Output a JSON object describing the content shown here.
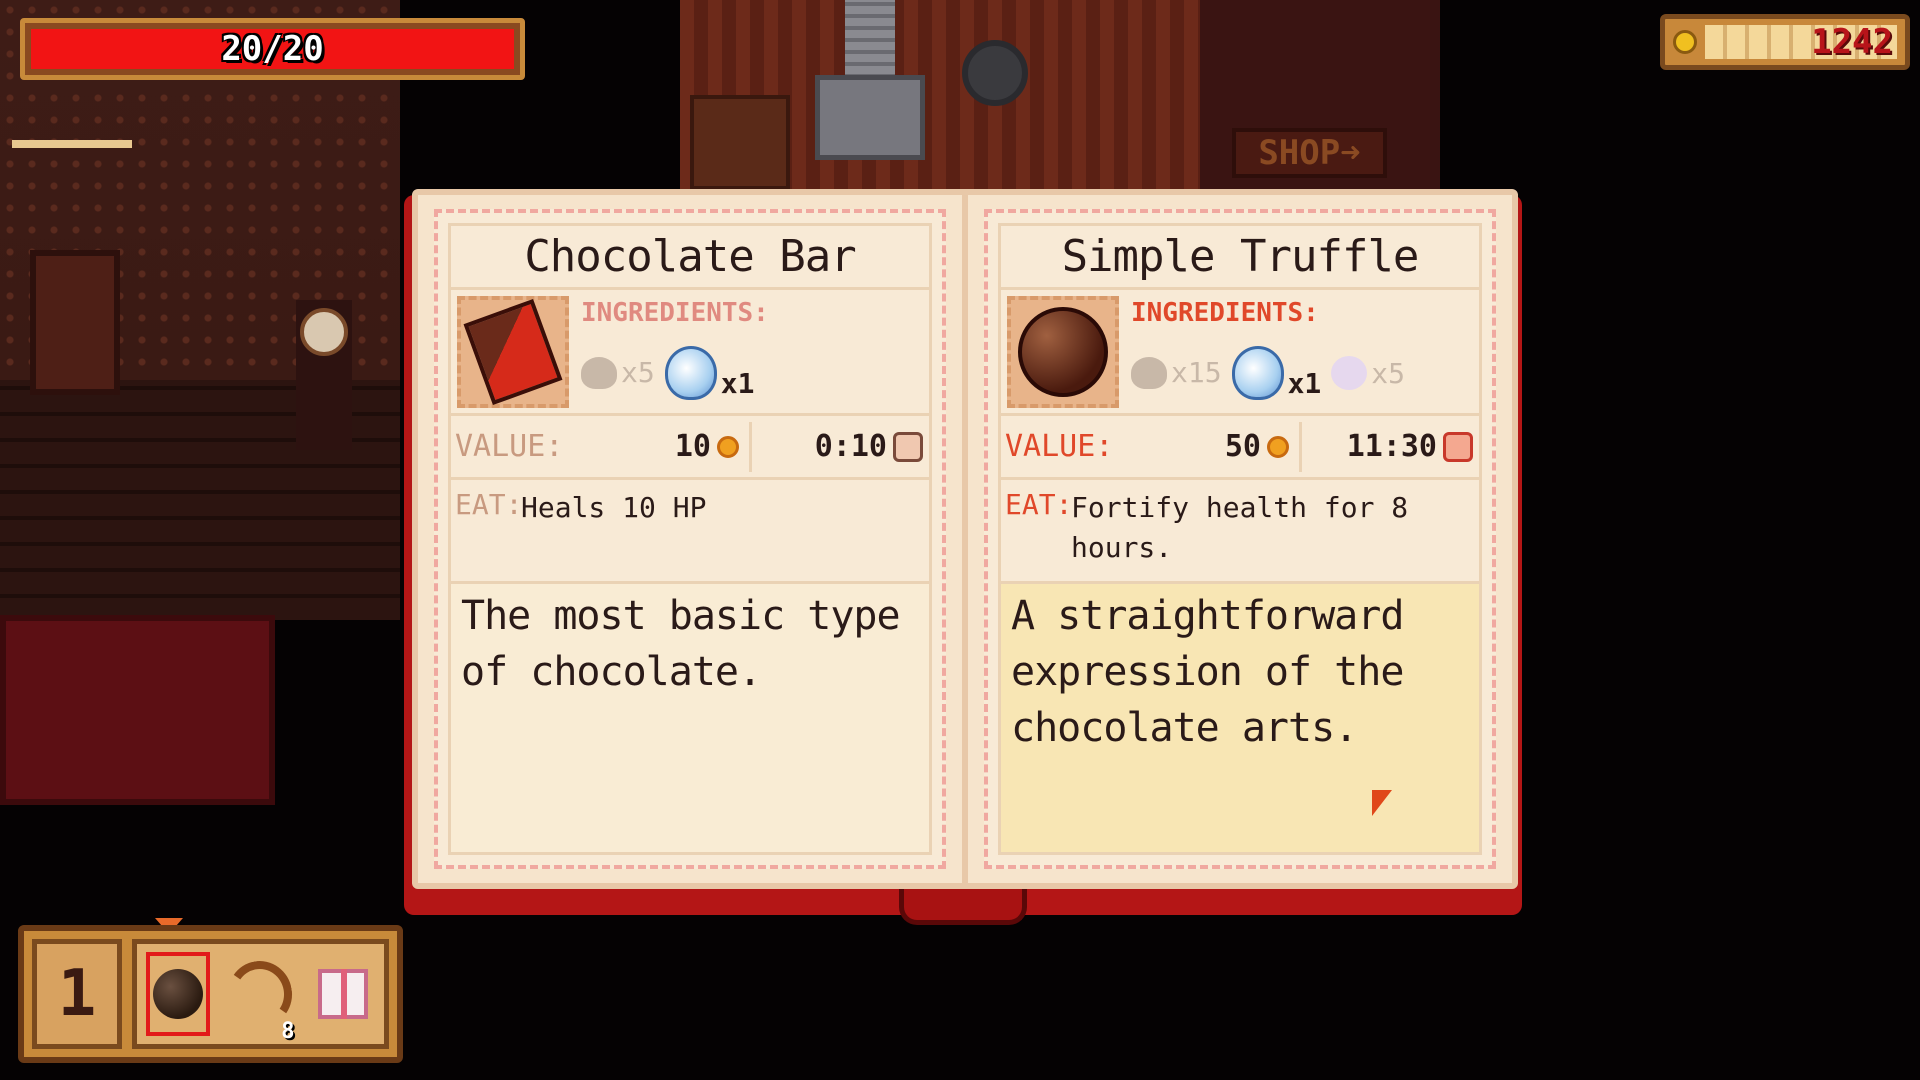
{
  "hud": {
    "health_text": "20/20",
    "money_text": "1242",
    "hotbar_number": "1",
    "hotbar_items": [
      {
        "icon": "truffle-icon",
        "selected": true
      },
      {
        "icon": "bow-and-arrow-icon",
        "count": "8"
      },
      {
        "icon": "gift-box-icon"
      }
    ]
  },
  "scene": {
    "shop_sign": "SHOP➜"
  },
  "recipes": [
    {
      "title": "Chocolate Bar",
      "icon": "chocolate-bar-icon",
      "ingredients_label": "INGREDIENTS:",
      "ingredients": [
        {
          "icon": "cocoa-bean-icon",
          "qty": "x5"
        },
        {
          "icon": "milk-bottle-icon",
          "qty": "x1"
        }
      ],
      "value_label": "VALUE:",
      "value": "10",
      "time": "0:10",
      "eat_label": "EAT:",
      "eat_text": "Heals 10 HP",
      "description": "The most basic type of chocolate."
    },
    {
      "title": "Simple Truffle",
      "icon": "truffle-icon",
      "ingredients_label": "INGREDIENTS:",
      "ingredients": [
        {
          "icon": "cocoa-bean-icon",
          "qty": "x15"
        },
        {
          "icon": "milk-bottle-icon",
          "qty": "x1"
        },
        {
          "icon": "pearl-icon",
          "qty": "x5"
        }
      ],
      "value_label": "VALUE:",
      "value": "50",
      "time": "11:30",
      "eat_label": "EAT:",
      "eat_text": "Fortify health for 8 hours.",
      "description": "A straightforward expression of the chocolate arts."
    }
  ],
  "colors": {
    "health": "#f21414",
    "money_text": "#b8141a",
    "book_cover": "#b41616",
    "accent_label": "#e0482a"
  }
}
